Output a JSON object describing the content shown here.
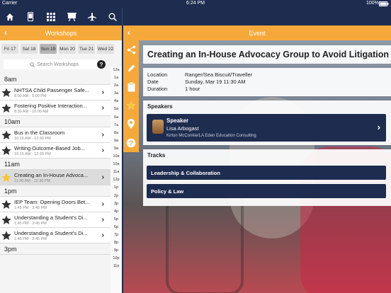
{
  "status": {
    "carrier": "Carrier",
    "time": "6:24 PM",
    "battery": "100%"
  },
  "nav_icons": [
    "home-icon",
    "phone-icon",
    "grid-icon",
    "presentation-icon",
    "airplane-icon",
    "search-icon"
  ],
  "workshops_header": {
    "title": "Workshops"
  },
  "event_header": {
    "title": "Event"
  },
  "days": [
    {
      "label": "Fri 17"
    },
    {
      "label": "Sat 18"
    },
    {
      "label": "Sun 19",
      "selected": true
    },
    {
      "label": "Mon 20"
    },
    {
      "label": "Tue 21"
    },
    {
      "label": "Wed 22"
    }
  ],
  "search": {
    "placeholder": "Search Workshops"
  },
  "schedule": [
    {
      "time": "8am",
      "items": [
        {
          "title": "NHTSA Child Passenger Safe...",
          "time": "8:00 AM - 5:00 PM",
          "starred": false
        },
        {
          "title": "Fostering Positive Interaction...",
          "time": "8:30 AM - 10:00 AM",
          "starred": false
        }
      ]
    },
    {
      "time": "10am",
      "items": [
        {
          "title": "Bus in the Classroom",
          "time": "10:15 AM - 12:30 PM",
          "starred": false
        },
        {
          "title": "Writing Outcome-Based Job...",
          "time": "10:15 AM - 12:30 PM",
          "starred": false
        }
      ]
    },
    {
      "time": "11am",
      "items": [
        {
          "title": "Creating an In-House Advoca...",
          "time": "11:30 AM - 12:30 PM",
          "starred": true,
          "active": true
        }
      ]
    },
    {
      "time": "1pm",
      "items": [
        {
          "title": "IEP Team: Opening Doors Bet...",
          "time": "1:45 PM - 3:45 PM",
          "starred": false
        },
        {
          "title": "Understanding a Student's Di...",
          "time": "1:45 PM - 3:45 PM",
          "starred": false
        },
        {
          "title": "Understanding a Student's Di...",
          "time": "1:45 PM - 3:45 PM",
          "starred": false
        }
      ]
    },
    {
      "time": "3pm",
      "items": []
    }
  ],
  "hour_index": [
    "12a",
    "1a",
    "2a",
    "3a",
    "4a",
    "5a",
    "6a",
    "7a",
    "8a",
    "9a",
    "9a",
    "10a",
    "10a",
    "11a",
    "12p",
    "1p",
    "2p",
    "3p",
    "4p",
    "5p",
    "6p",
    "7p",
    "8p",
    "9p",
    "10p",
    "11p"
  ],
  "event": {
    "title": "Creating an In-House Advocacy Group to Avoid Litigation",
    "details": [
      {
        "label": "Location",
        "value": "Ranger/Sea Biscuit/Traveller"
      },
      {
        "label": "Date",
        "value": "Sunday, Mar 19 11:30 AM"
      },
      {
        "label": "Duration",
        "value": "1 hour"
      }
    ],
    "speakers_heading": "Speakers",
    "speaker": {
      "role": "Speaker",
      "name": "Lisa Arbogast",
      "organization": "Kirton McConkie/LA Eden Education Consulting"
    },
    "tracks_heading": "Tracks",
    "tracks": [
      "Leadership & Collaboration",
      "Policy & Law"
    ]
  },
  "actions": [
    "share-icon",
    "pencil-icon",
    "clipboard-icon",
    "star-icon",
    "map-pin-icon",
    "question-icon"
  ],
  "colors": {
    "navy": "#1d2c4f",
    "orange": "#f6a93b",
    "star_gold": "#f7c531",
    "star_dark": "#333333"
  }
}
